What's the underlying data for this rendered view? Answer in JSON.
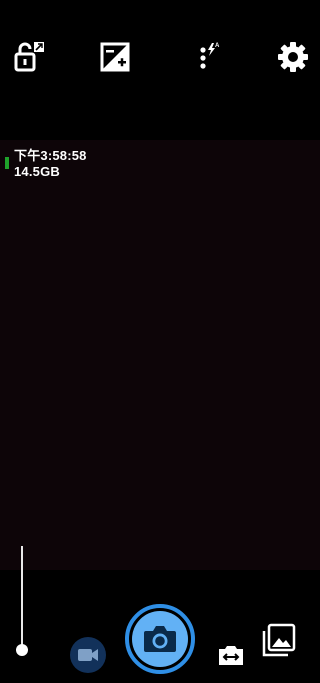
{
  "top_icons": [
    {
      "name": "unlock-rotation-icon"
    },
    {
      "name": "exposure-compensation-icon"
    },
    {
      "name": "flash-auto-menu-icon"
    },
    {
      "name": "settings-gear-icon"
    }
  ],
  "overlay": {
    "time": "下午3:58:58",
    "storage": "14.5GB",
    "battery_color": "#1fa22b"
  },
  "controls": {
    "zoom_level": 0,
    "accent": "#2f8fe6",
    "shutter_fill": "#62b1f5",
    "video_bg": "#12315a"
  }
}
